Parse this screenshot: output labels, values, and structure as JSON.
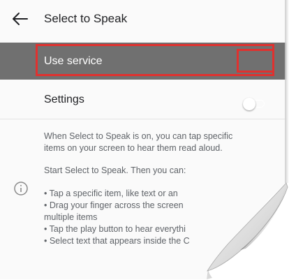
{
  "header": {
    "title": "Select to Speak",
    "back_icon": "arrow-left-icon"
  },
  "service": {
    "label": "Use service",
    "enabled": false
  },
  "settings": {
    "label": "Settings"
  },
  "info": {
    "icon": "info-icon",
    "description_lines": [
      "When Select to Speak is on, you can tap specific",
      "items on your screen to hear them read aloud."
    ],
    "start_line": "Start Select to Speak. Then you can:",
    "bullets": [
      "• Tap a specific item, like text or an",
      "• Drag your finger across the screen",
      "multiple items",
      "• Tap the play button to hear everythi",
      "• Select text that appears inside the C"
    ]
  },
  "colors": {
    "highlight": "#e0312f",
    "service_row_bg": "#707070"
  }
}
